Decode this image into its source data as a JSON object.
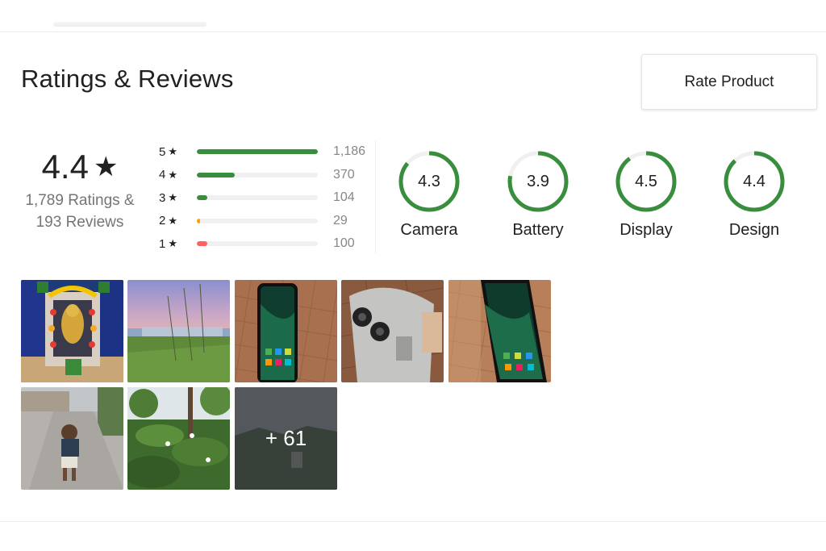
{
  "section": {
    "title": "Ratings & Reviews",
    "rate_button_label": "Rate Product"
  },
  "summary": {
    "average": "4.4",
    "star_glyph": "★",
    "ratings_line": "1,789 Ratings &",
    "reviews_line": "193 Reviews"
  },
  "distribution": [
    {
      "stars": "5",
      "count": "1,186",
      "fraction": 1.0,
      "color": "#388e3c"
    },
    {
      "stars": "4",
      "count": "370",
      "fraction": 0.31,
      "color": "#388e3c"
    },
    {
      "stars": "3",
      "count": "104",
      "fraction": 0.088,
      "color": "#388e3c"
    },
    {
      "stars": "2",
      "count": "29",
      "fraction": 0.024,
      "color": "#ff9f00"
    },
    {
      "stars": "1",
      "count": "100",
      "fraction": 0.084,
      "color": "#ff6161"
    }
  ],
  "aspects": [
    {
      "name": "Camera",
      "value": "4.3",
      "fraction": 0.86
    },
    {
      "name": "Battery",
      "value": "3.9",
      "fraction": 0.78
    },
    {
      "name": "Display",
      "value": "4.5",
      "fraction": 0.9
    },
    {
      "name": "Design",
      "value": "4.4",
      "fraction": 0.88
    }
  ],
  "colors": {
    "ring_fill": "#388e3c",
    "ring_track": "#f0f0f0"
  },
  "gallery": {
    "images": [
      {
        "name": "photo-temple-idol"
      },
      {
        "name": "photo-field-sky"
      },
      {
        "name": "photo-phone-screen-1"
      },
      {
        "name": "photo-phone-back"
      },
      {
        "name": "photo-phone-screen-2"
      },
      {
        "name": "photo-child-street"
      },
      {
        "name": "photo-green-plants"
      },
      {
        "name": "photo-more"
      }
    ],
    "more_label": "+ 61"
  }
}
